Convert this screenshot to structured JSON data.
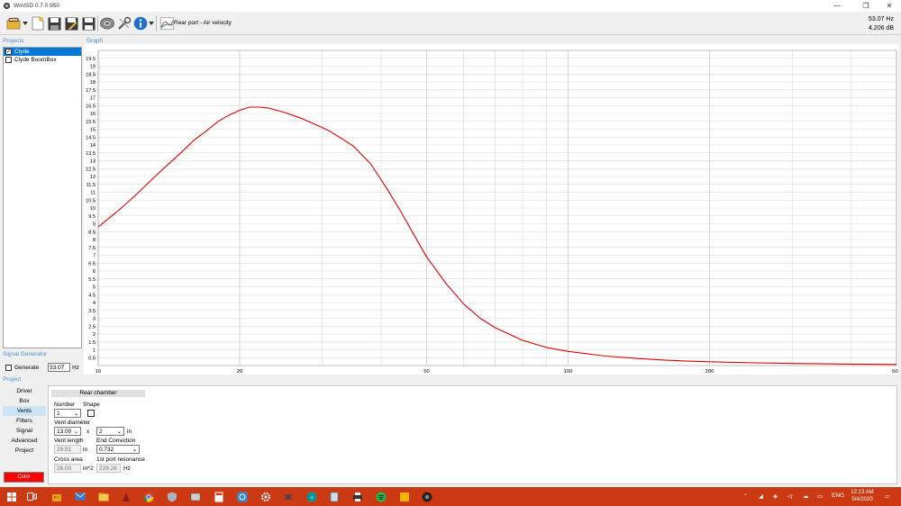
{
  "window": {
    "title": "WinISD 0.7.0.950",
    "minimize": "—",
    "restore": "❐",
    "close": "✕"
  },
  "toolbar": {
    "buttons": [
      "open-project-icon",
      "dropdown-arrow-icon",
      "new-project-icon",
      "save-icon",
      "save-as-icon",
      "save-all-icon",
      "driver-editor-icon",
      "tools-icon",
      "info-icon"
    ],
    "graph_select_label": "Rear port - Air velocity"
  },
  "readout": {
    "frequency": "53.07 Hz",
    "value": "4.206 dB"
  },
  "projects": {
    "label": "Projects",
    "items": [
      {
        "name": "Clyde",
        "checked": true
      },
      {
        "name": "Clyde BoomBox",
        "checked": false
      }
    ]
  },
  "graph": {
    "label": "Graph"
  },
  "signal_generator": {
    "label": "Signal Generator",
    "generate_label": "Generate",
    "frequency": "53.07",
    "unit": "Hz"
  },
  "project": {
    "label": "Project",
    "nav": [
      "Driver",
      "Box",
      "Vents",
      "Filters",
      "Signal",
      "Advanced",
      "Project"
    ],
    "selected_nav": "Vents",
    "color_label": "Color"
  },
  "vents": {
    "chamber": "Rear chamber",
    "number_label": "Number",
    "number_value": "1",
    "shape_label": "Shape",
    "diameter_label": "Vent diameter",
    "diameter_value": "13.00",
    "x_label": "x",
    "count_value": "2",
    "diameter_unit": "in",
    "length_label": "Vent length",
    "length_value": "29.51",
    "length_unit": "in",
    "end_correction_label": "End Correction",
    "end_correction_value": "0.732",
    "cross_area_label": "Cross area",
    "cross_area_value": "26.00",
    "cross_area_unit": "in^2",
    "resonance_label": "1st port resonance",
    "resonance_value": "229.26",
    "resonance_unit": "Hz"
  },
  "taskbar": {
    "language": "ENG",
    "time": "12:13 AM",
    "date": "5/4/2020"
  },
  "chart_data": {
    "type": "line",
    "title": "",
    "xlabel": "",
    "ylabel": "",
    "x_scale": "log",
    "xlim": [
      10,
      500
    ],
    "ylim": [
      0,
      20
    ],
    "grid": true,
    "y_ticks": [
      "0.5",
      "1",
      "1.5",
      "2",
      "2.5",
      "3",
      "3.5",
      "4",
      "4.5",
      "5",
      "5.5",
      "6",
      "6.5",
      "7",
      "7.5",
      "8",
      "8.5",
      "9",
      "9.5",
      "10",
      "10.5",
      "11",
      "11.5",
      "12",
      "12.5",
      "13",
      "13.5",
      "14",
      "14.5",
      "15",
      "15.5",
      "16",
      "16.5",
      "17",
      "17.5",
      "18",
      "18.5",
      "19",
      "19.5"
    ],
    "x_tick_labels": [
      "10",
      "20",
      "50",
      "100",
      "200",
      "500"
    ],
    "series": [
      {
        "color": "#e00000",
        "x": [
          10,
          11,
          12,
          13,
          14,
          15,
          16,
          17,
          18,
          19,
          20,
          21,
          22,
          23,
          24,
          25,
          27,
          29,
          31,
          33,
          35,
          38,
          41,
          44,
          47,
          50,
          55,
          60,
          65,
          70,
          80,
          90,
          100,
          120,
          140,
          160,
          180,
          200,
          250,
          300,
          350,
          400,
          450,
          500
        ],
        "y": [
          8.8,
          9.8,
          10.8,
          11.8,
          12.7,
          13.5,
          14.3,
          14.9,
          15.5,
          15.9,
          16.2,
          16.4,
          16.4,
          16.35,
          16.2,
          16.05,
          15.7,
          15.3,
          14.9,
          14.4,
          13.9,
          12.8,
          11.3,
          9.8,
          8.3,
          6.9,
          5.2,
          3.9,
          3.0,
          2.4,
          1.6,
          1.15,
          0.9,
          0.6,
          0.45,
          0.35,
          0.28,
          0.24,
          0.17,
          0.13,
          0.11,
          0.09,
          0.08,
          0.07
        ]
      }
    ]
  }
}
